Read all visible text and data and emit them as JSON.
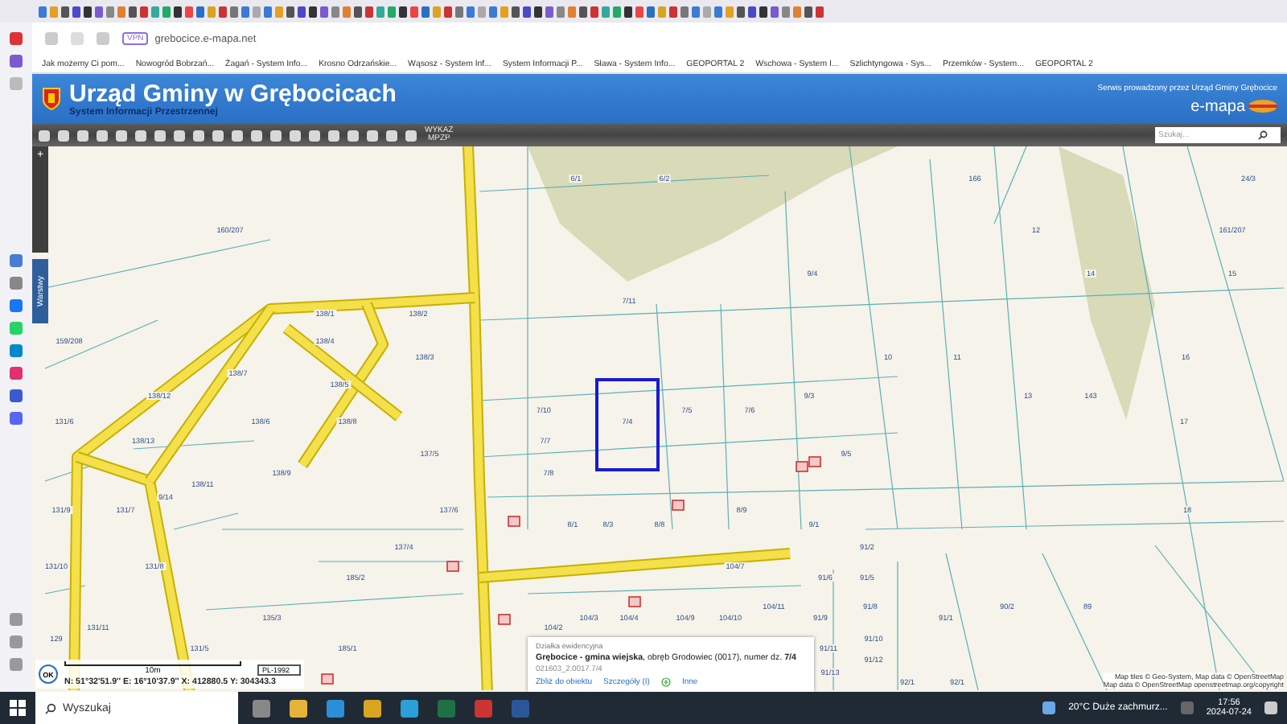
{
  "browser": {
    "vpn_badge": "VPN",
    "address": "grebocice.e-mapa.net",
    "bookmarks": [
      "Jak możemy Ci pom...",
      "Nowogród Bobrzań...",
      "Żagań - System Info...",
      "Krosno Odrzańskie...",
      "Wąsosz - System Inf...",
      "System Informacji P...",
      "Sława - System Info...",
      "GEOPORTAL 2",
      "Wschowa - System I...",
      "Szlichtyngowa - Sys...",
      "Przemków - System...",
      "GEOPORTAL 2"
    ]
  },
  "header": {
    "title": "Urząd Gminy w Grębocicach",
    "subtitle": "System Informacji Przestrzennej",
    "service_note": "Serwis prowadzony przez Urząd Gminy Grębocice",
    "brand": "e-mapa"
  },
  "toolbar": {
    "plan_button": [
      "WYKAZ",
      "MPZP"
    ],
    "search": {
      "placeholder": "Szukaj..."
    }
  },
  "map": {
    "zoom_in": "+",
    "layers_tab": "Warstwy",
    "parcel_labels": [
      "6/1",
      "6/2",
      "166",
      "24/3",
      "160/207",
      "12",
      "161/207",
      "9/4",
      "14",
      "15",
      "7/11",
      "138/1",
      "138/2",
      "159/208",
      "138/4",
      "138/3",
      "10",
      "11",
      "16",
      "138/7",
      "138/5",
      "138/12",
      "9/3",
      "13",
      "143",
      "7/10",
      "7/5",
      "7/6",
      "131/6",
      "138/6",
      "138/8",
      "7/4",
      "17",
      "138/13",
      "7/7",
      "137/5",
      "9/5",
      "138/9",
      "7/8",
      "138/11",
      "9/14",
      "131/9",
      "131/7",
      "137/6",
      "8/9",
      "18",
      "8/1",
      "8/3",
      "8/8",
      "9/1",
      "137/4",
      "91/2",
      "131/10",
      "131/8",
      "104/7",
      "185/2",
      "91/6",
      "91/5",
      "104/11",
      "91/8",
      "90/2",
      "89",
      "135/3",
      "104/3",
      "104/4",
      "104/9",
      "104/10",
      "91/9",
      "91/1",
      "131/11",
      "104/2",
      "129",
      "91/10",
      "131/5",
      "185/1",
      "91/11",
      "91/12",
      "91/13",
      "92/1",
      "92/1"
    ],
    "popup": {
      "heading": "Działka ewidencyjna",
      "description": "**Grębocice - gmina wiejska**, obręb Grodowiec (0017), numer dz. **7/4**",
      "identifier": "021603_2.0017.7/4",
      "links": [
        "Zbliż do obiektu",
        "Szczegóły (I)",
        "Inne"
      ]
    },
    "attribution": [
      "Map tiles © Geo-System, Map data © OpenStreetMap",
      "Map data © OpenStreetMap   openstreetmap.org/copyright"
    ],
    "scale": "10m",
    "crs": "PL-1992",
    "crs_badge": "OK",
    "coordinates": "N: 51°32'51.9''  E: 16°10'37.9''   X: 412880.5   Y: 304343.3"
  },
  "taskbar": {
    "search_placeholder": "Wyszukaj",
    "weather": "20°C  Duże zachmurz...",
    "time": "17:56",
    "date": "2024-07-24"
  }
}
